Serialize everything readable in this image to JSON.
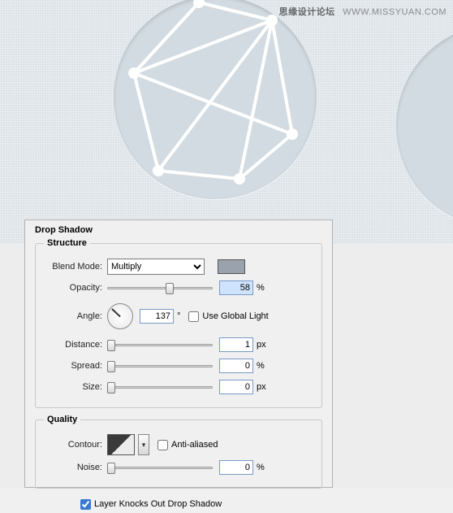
{
  "watermark": {
    "cn": "思缘设计论坛",
    "en": "WWW.MISSYUAN.COM"
  },
  "panel": {
    "title": "Drop Shadow"
  },
  "structure": {
    "legend": "Structure",
    "blend_mode_label": "Blend Mode:",
    "blend_mode_value": "Multiply",
    "opacity_label": "Opacity:",
    "opacity_value": "58",
    "opacity_unit": "%",
    "angle_label": "Angle:",
    "angle_value": "137",
    "angle_unit": "°",
    "global_light_label": "Use Global Light",
    "distance_label": "Distance:",
    "distance_value": "1",
    "distance_unit": "px",
    "spread_label": "Spread:",
    "spread_value": "0",
    "spread_unit": "%",
    "size_label": "Size:",
    "size_value": "0",
    "size_unit": "px",
    "swatch_color": "#9aa3ad"
  },
  "quality": {
    "legend": "Quality",
    "contour_label": "Contour:",
    "anti_aliased_label": "Anti-aliased",
    "noise_label": "Noise:",
    "noise_value": "0",
    "noise_unit": "%"
  },
  "footer": {
    "knockout_label": "Layer Knocks Out Drop Shadow"
  }
}
